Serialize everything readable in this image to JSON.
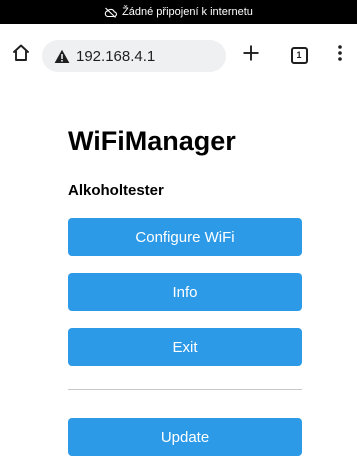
{
  "status_bar": {
    "icon": "cloud-off-icon",
    "text": "Žádné připojení k internetu"
  },
  "browser": {
    "url": "192.168.4.1",
    "tabs_count": "1",
    "icons": {
      "home": "home-icon",
      "security": "not-secure-warning-icon",
      "new_tab": "plus-icon",
      "tabs": "tab-switcher-icon",
      "menu": "more-vertical-icon"
    }
  },
  "page": {
    "title": "WiFiManager",
    "subtitle": "Alkoholtester",
    "buttons": {
      "configure": "Configure WiFi",
      "info": "Info",
      "exit": "Exit",
      "update": "Update"
    },
    "colors": {
      "button_bg": "#2d9ae7",
      "button_text": "#ffffff"
    }
  }
}
